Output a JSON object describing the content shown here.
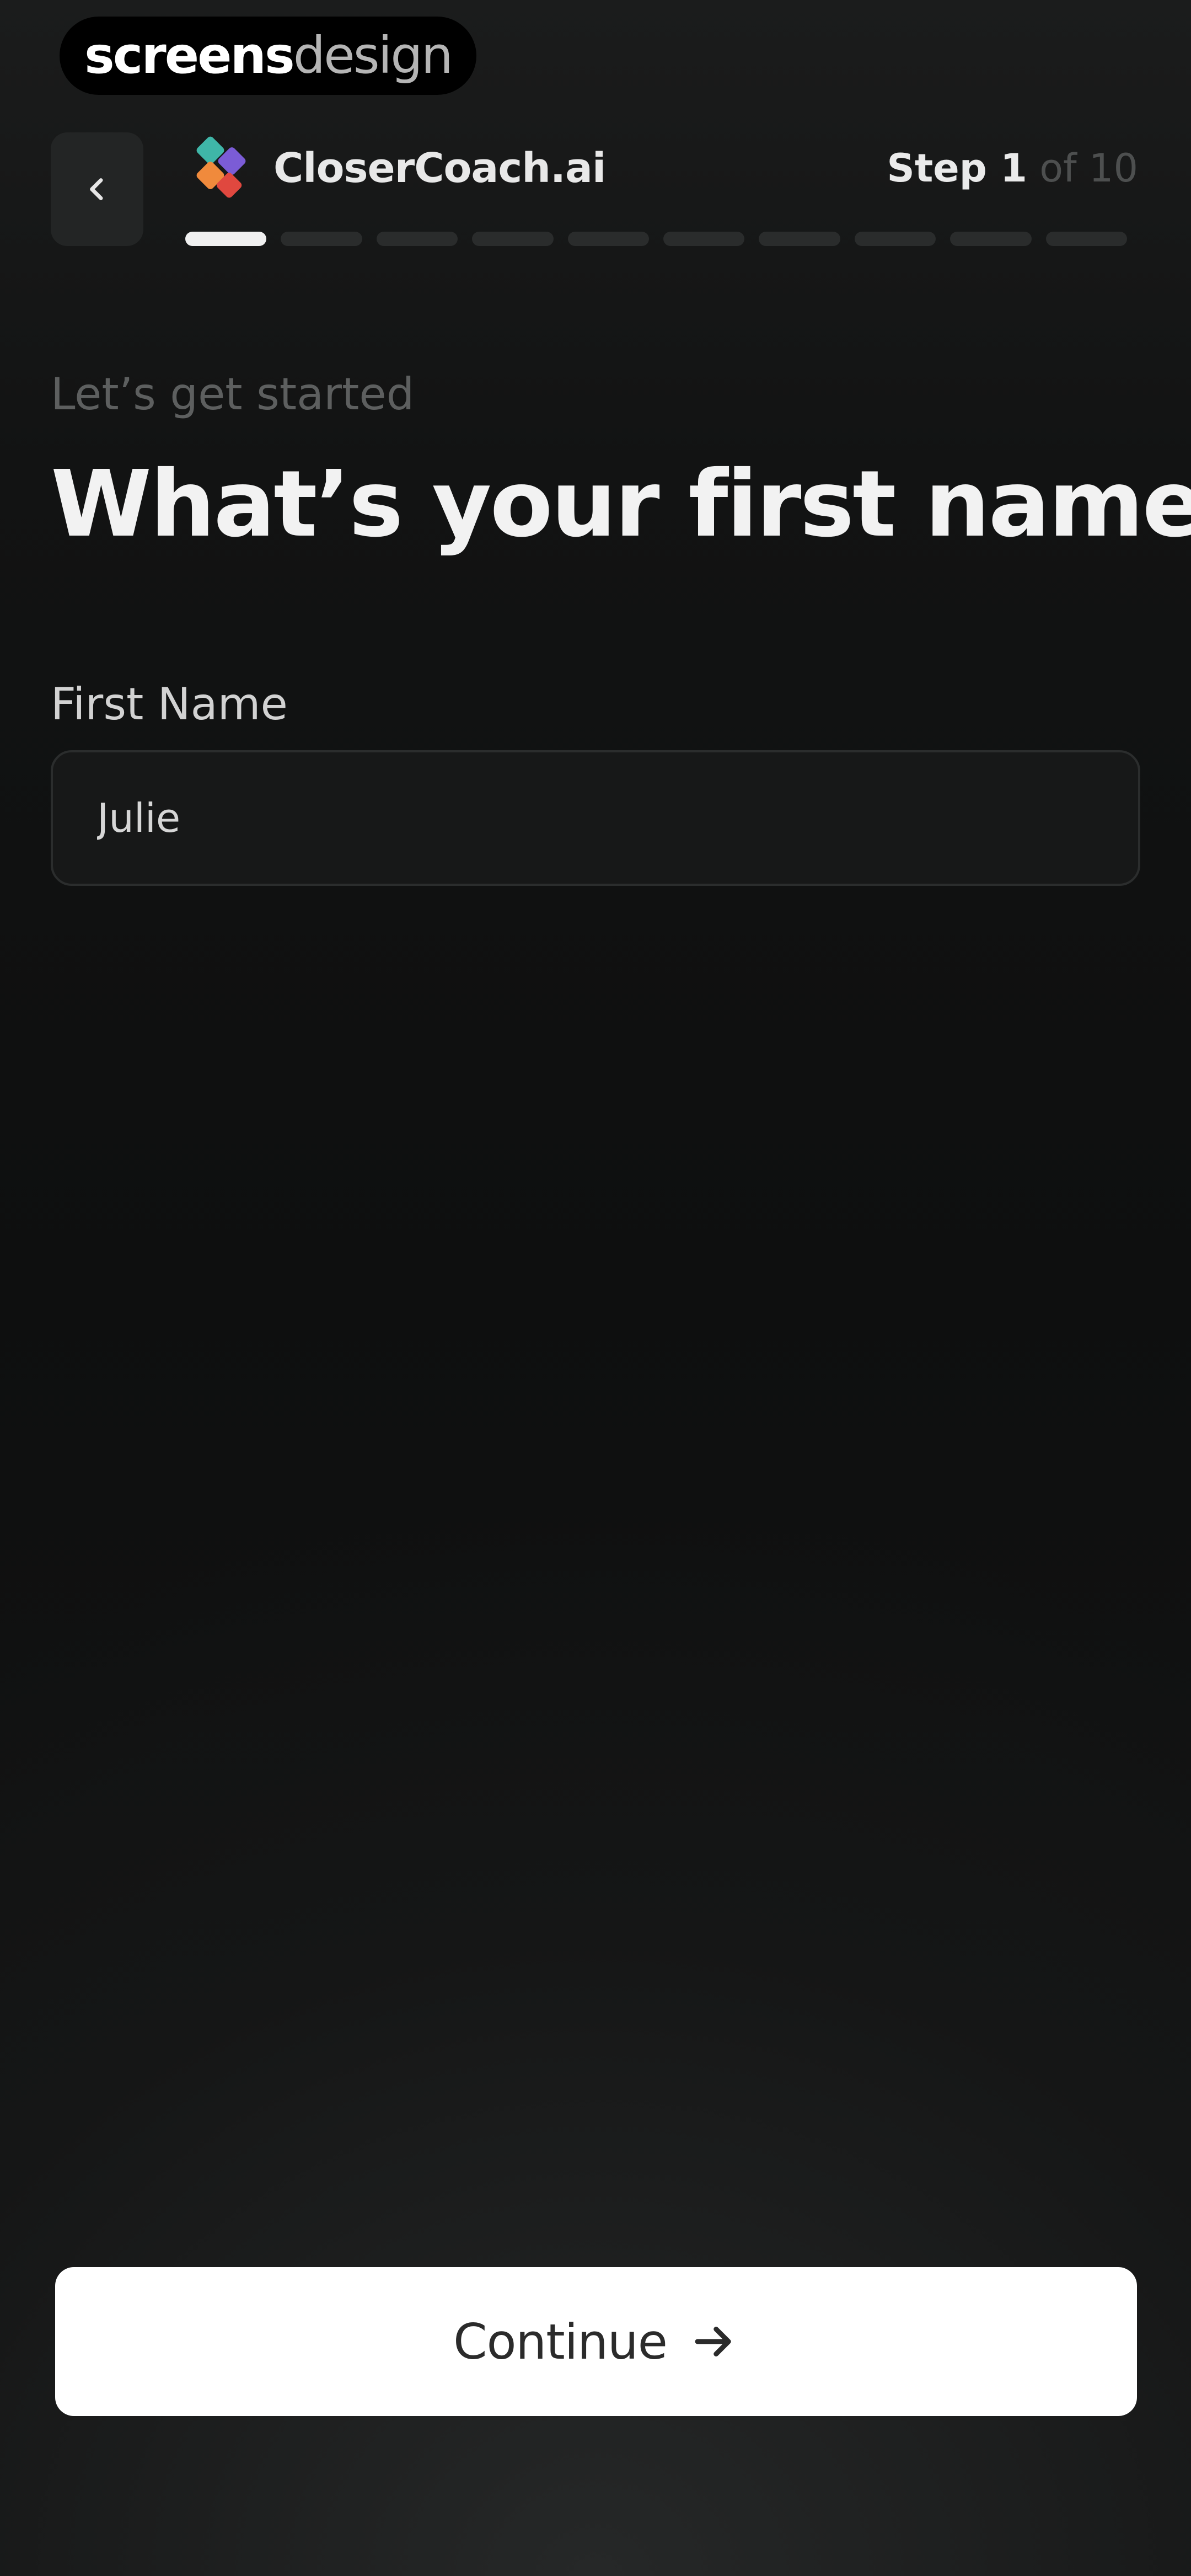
{
  "watermark": {
    "strong": "screens",
    "light": "design"
  },
  "header": {
    "back_icon": "chevron-left-icon",
    "brand_name": "CloserCoach.ai",
    "brand_logo_icon": "closercoach-logo-icon",
    "step_prefix": "Step 1",
    "step_suffix": " of 10",
    "progress": {
      "current_step": 1,
      "total_steps": 10
    }
  },
  "content": {
    "eyebrow": "Let’s get started",
    "headline": "What’s your first name?",
    "field_label": "First Name",
    "field_value": "Julie"
  },
  "footer": {
    "continue_label": "Continue",
    "continue_icon": "arrow-right-icon"
  },
  "colors": {
    "background": "#0f1010",
    "accent_text": "#ffffff",
    "muted_text": "#5d5f5f",
    "progress_active": "#f0f0f0",
    "progress_inactive": "#2a2c2c",
    "button_bg": "#ffffff",
    "logo_teal": "#3fb6a8",
    "logo_red": "#e0483f",
    "logo_orange": "#f08a3c",
    "logo_purple": "#7b5cd6"
  }
}
